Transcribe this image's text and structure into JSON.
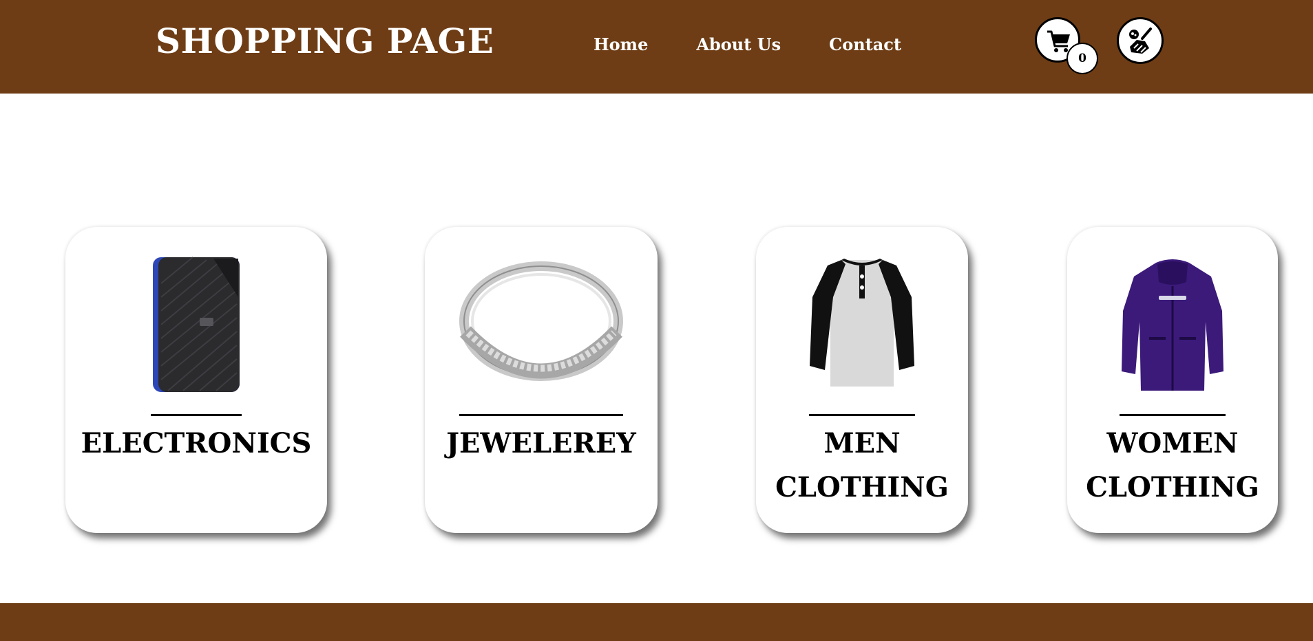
{
  "header": {
    "brand": "SHOPPING PAGE",
    "nav": [
      {
        "label": "Home"
      },
      {
        "label": "About Us"
      },
      {
        "label": "Contact"
      }
    ],
    "cart_count": "0",
    "icons": [
      "cart-icon",
      "broom-clean-icon"
    ],
    "background_color": "#6e3d15"
  },
  "categories": [
    {
      "label": "ELECTRONICS",
      "image": "external-hard-drive"
    },
    {
      "label": "JEWELEREY",
      "image": "silver-ring"
    },
    {
      "label_line1": "MEN",
      "label_line2": "CLOTHING",
      "image": "raglan-t-shirt"
    },
    {
      "label_line1": "WOMEN",
      "label_line2": "CLOTHING",
      "image": "purple-jacket"
    }
  ],
  "footer": {
    "background_color": "#6e3d15"
  }
}
